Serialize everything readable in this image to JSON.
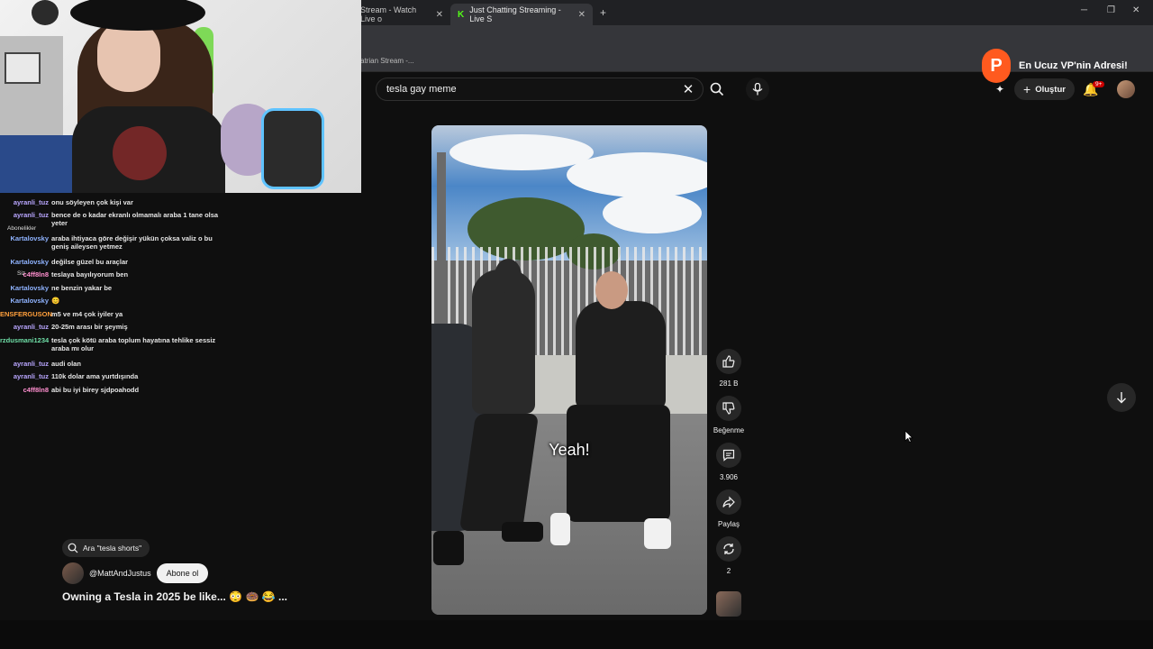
{
  "browser": {
    "tabs": [
      {
        "label": "Stream - Watch Live o"
      },
      {
        "label": "Just Chatting Streaming - Live S"
      }
    ],
    "bookmark": "atrian Stream -..."
  },
  "ad_banner": {
    "text": "En Ucuz VP'nin Adresi!"
  },
  "chat": {
    "side_label": "Abonelikler",
    "side_label2": "Siz",
    "messages": [
      {
        "user": "ayranli_tuz",
        "text": "onu söyleyen çok kişi var"
      },
      {
        "user": "ayranli_tuz",
        "text": "bence de o kadar ekranlı olmamalı araba 1 tane olsa yeter"
      },
      {
        "user": "Kartalovsky",
        "text": "araba ihtiyaca göre değişir yükün çoksa valiz o bu geniş aileysen yetmez"
      },
      {
        "user": "Kartalovsky",
        "text": "değilse güzel bu araçlar"
      },
      {
        "user": "c4ff8ln8",
        "text": "teslaya bayılıyorum ben"
      },
      {
        "user": "Kartalovsky",
        "text": "ne benzin yakar be"
      },
      {
        "user": "Kartalovsky",
        "text": "😊"
      },
      {
        "user": "ENSFERGUSON",
        "text": "m5 ve m4 çok iyiler ya"
      },
      {
        "user": "ayranli_tuz",
        "text": "20-25m arası bir şeymiş"
      },
      {
        "user": "rzdusmani1234",
        "text": "tesla çok kötü araba toplum hayatına tehlike sessiz araba mı olur"
      },
      {
        "user": "ayranli_tuz",
        "text": "audi olan"
      },
      {
        "user": "ayranli_tuz",
        "text": "110k dolar ama yurtdışında"
      },
      {
        "user": "c4ff8ln8",
        "text": "abi bu iyi birey sjdpoahodd"
      }
    ]
  },
  "search": {
    "query": "tesla gay meme"
  },
  "header": {
    "create_label": "Oluştur",
    "notif_count": "9+"
  },
  "video": {
    "caption": "Yeah!"
  },
  "actions": {
    "like_count": "281 B",
    "dislike_label": "Beğenme",
    "comment_count": "3.906",
    "share_label": "Paylaş",
    "remix_count": "2"
  },
  "short": {
    "related_search": "Ara \"tesla shorts\"",
    "channel": "@MattAndJustus",
    "subscribe_label": "Abone ol",
    "title": "Owning a Tesla in 2025 be like... 😳 🍩 😂 ..."
  }
}
